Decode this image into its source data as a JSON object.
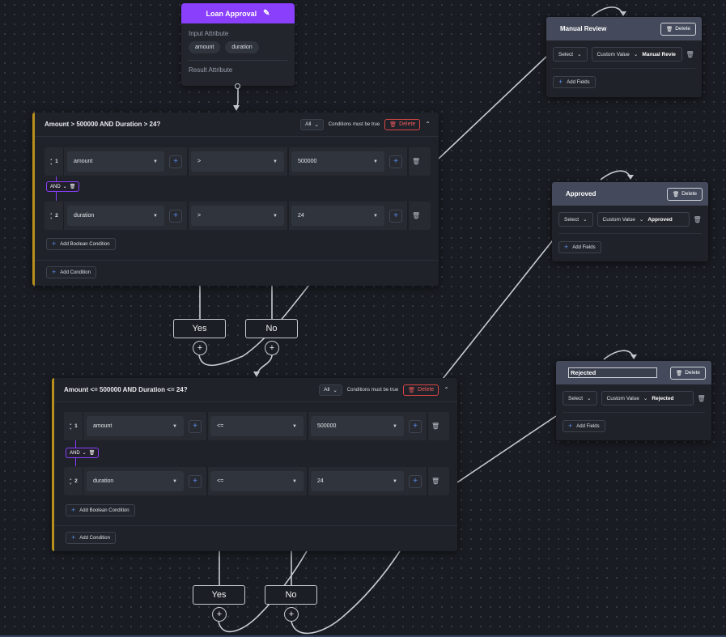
{
  "start_node": {
    "title": "Loan Approval",
    "input_label": "Input Attribute",
    "chips": [
      "amount",
      "duration"
    ],
    "result_label": "Result Attribute"
  },
  "conditions": [
    {
      "title": "Amount > 500000 AND Duration > 24?",
      "mode": "All",
      "must": "Conditions must be true",
      "delete": "Delete",
      "rows": [
        {
          "num": "1",
          "attribute": "amount",
          "operator": ">",
          "value": "500000"
        },
        {
          "num": "2",
          "attribute": "duration",
          "operator": ">",
          "value": "24"
        }
      ],
      "join": "AND",
      "add_bool": "Add Boolean Condition",
      "add_cond": "Add Condition",
      "yes": "Yes",
      "no": "No"
    },
    {
      "title": "Amount <= 500000 AND Duration <= 24?",
      "mode": "All",
      "must": "Conditions must be true",
      "delete": "Delete",
      "rows": [
        {
          "num": "1",
          "attribute": "amount",
          "operator": "<=",
          "value": "500000"
        },
        {
          "num": "2",
          "attribute": "duration",
          "operator": "<=",
          "value": "24"
        }
      ],
      "join": "AND",
      "add_bool": "Add Boolean Condition",
      "add_cond": "Add Condition",
      "yes": "Yes",
      "no": "No"
    }
  ],
  "results": [
    {
      "title": "Manual Review",
      "delete": "Delete",
      "select": "Select",
      "type": "Custom Value",
      "value": "Manual Revie",
      "add_fields": "Add Fields"
    },
    {
      "title": "Approved",
      "delete": "Delete",
      "select": "Select",
      "type": "Custom Value",
      "value": "Approved",
      "add_fields": "Add Fields"
    },
    {
      "title": "Rejected",
      "delete": "Delete",
      "select": "Select",
      "type": "Custom Value",
      "value": "Rejected",
      "add_fields": "Add Fields"
    }
  ],
  "icons": {
    "edit": "pencil-icon",
    "delete": "trash-icon",
    "add": "plus-icon",
    "collapse": "chevron-up-icon",
    "dropdown": "chevron-down-icon"
  },
  "colors": {
    "accent": "#8a3ffc",
    "condition_border": "#b8901c",
    "danger": "#ef5a5a",
    "result_header": "#444a5b",
    "link": "#5a8dee"
  }
}
